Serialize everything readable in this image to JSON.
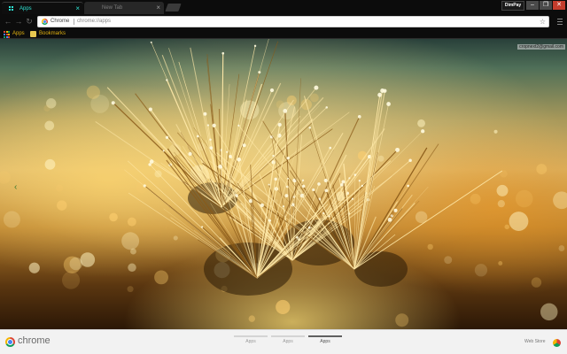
{
  "tabs": [
    {
      "label": "Apps",
      "active": true
    },
    {
      "label": "New Tab",
      "active": false
    }
  ],
  "window": {
    "profile_label": "DimPay",
    "minimize_glyph": "–",
    "maximize_glyph": "❐",
    "close_glyph": "✕"
  },
  "toolbar": {
    "back_glyph": "←",
    "forward_glyph": "→",
    "reload_glyph": "↻",
    "chip_label": "Chrome",
    "url": "chrome://apps",
    "star_glyph": "☆"
  },
  "bookmarks": [
    {
      "label": "Apps",
      "icon": "apps-grid-icon"
    },
    {
      "label": "Bookmarks",
      "icon": "folder-icon"
    }
  ],
  "content": {
    "user_email": "cropnext2@gmail.com",
    "chevron_glyph": "‹"
  },
  "launcher": {
    "brand": "chrome",
    "pages": [
      {
        "label": "Apps",
        "active": false
      },
      {
        "label": "Apps",
        "active": false
      },
      {
        "label": "Apps",
        "active": true
      }
    ],
    "webstore_label": "Web Store"
  },
  "colors": {
    "tab_accent": "#2ee6d6",
    "bookmark_text": "#e0b010",
    "chrome_red": "#db4437",
    "chrome_green": "#0f9d58",
    "chrome_yellow": "#f4b400",
    "chrome_blue": "#4285f4"
  }
}
